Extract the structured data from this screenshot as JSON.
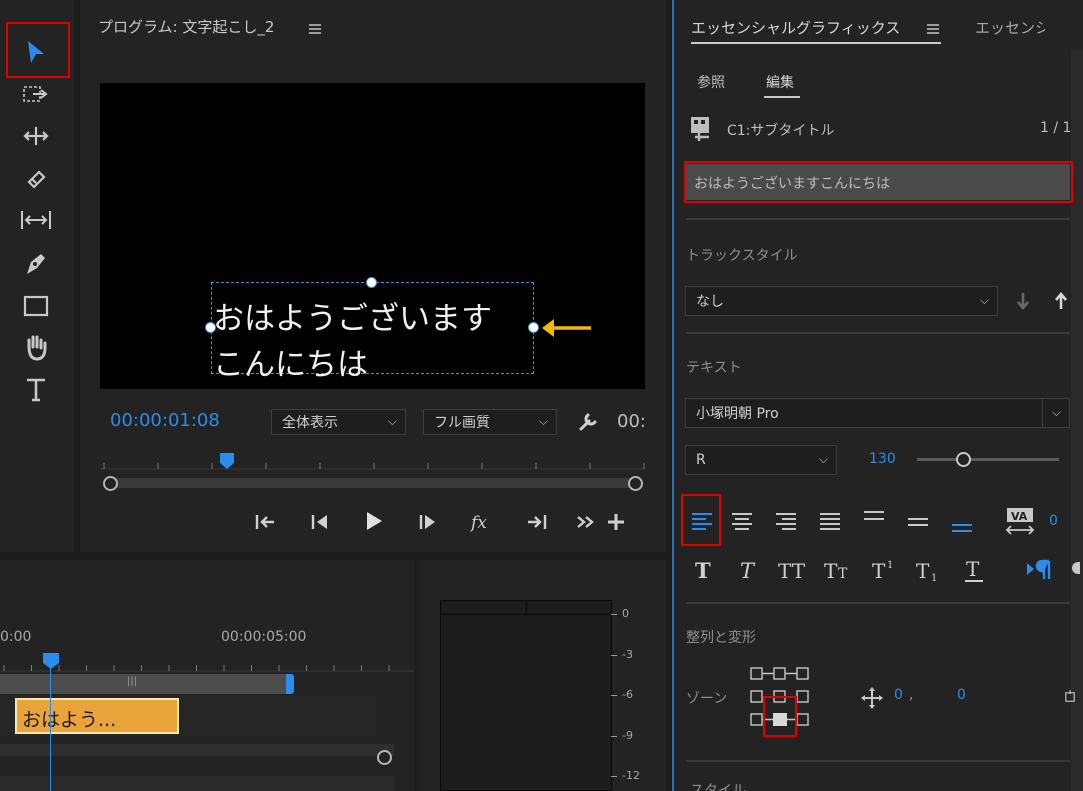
{
  "program": {
    "title": "プログラム: 文字起こし_2",
    "timecode": "00:00:01:08",
    "fit_select": "全体表示",
    "quality_select": "フル画質",
    "timecode_right": "00:",
    "caption_line1": "おはようございます",
    "caption_line2": "こんにちは"
  },
  "timeline": {
    "time_left": "0:00",
    "time_right": "00:00:05:00",
    "clip_label": "おはよう...",
    "meter_ticks": [
      "0",
      "-3",
      "-6",
      "-9",
      "-12"
    ]
  },
  "essential_graphics": {
    "tab_active": "エッセンシャルグラフィックス",
    "tab_other": "エッセンシ",
    "subtab_browse": "参照",
    "subtab_edit": "編集",
    "layer_name": "C1:サブタイトル",
    "layer_count": "1 / 1",
    "caption_text": "おはようございますこんにちは",
    "track_style_label": "トラックスタイル",
    "track_style_value": "なし",
    "text_label": "テキスト",
    "font_value": "小塚明朝 Pro",
    "font_style_value": "R",
    "font_size": "130",
    "tracking_value": "0",
    "align_label": "整列と変形",
    "zone_label": "ゾーン",
    "pos_x": "0",
    "pos_y": "0",
    "bottom_label": "スタイル"
  },
  "colors": {
    "accent": "#2d8ceb",
    "highlight": "#e00000",
    "clip": "#e8a33a",
    "arrow": "#f5b800"
  }
}
